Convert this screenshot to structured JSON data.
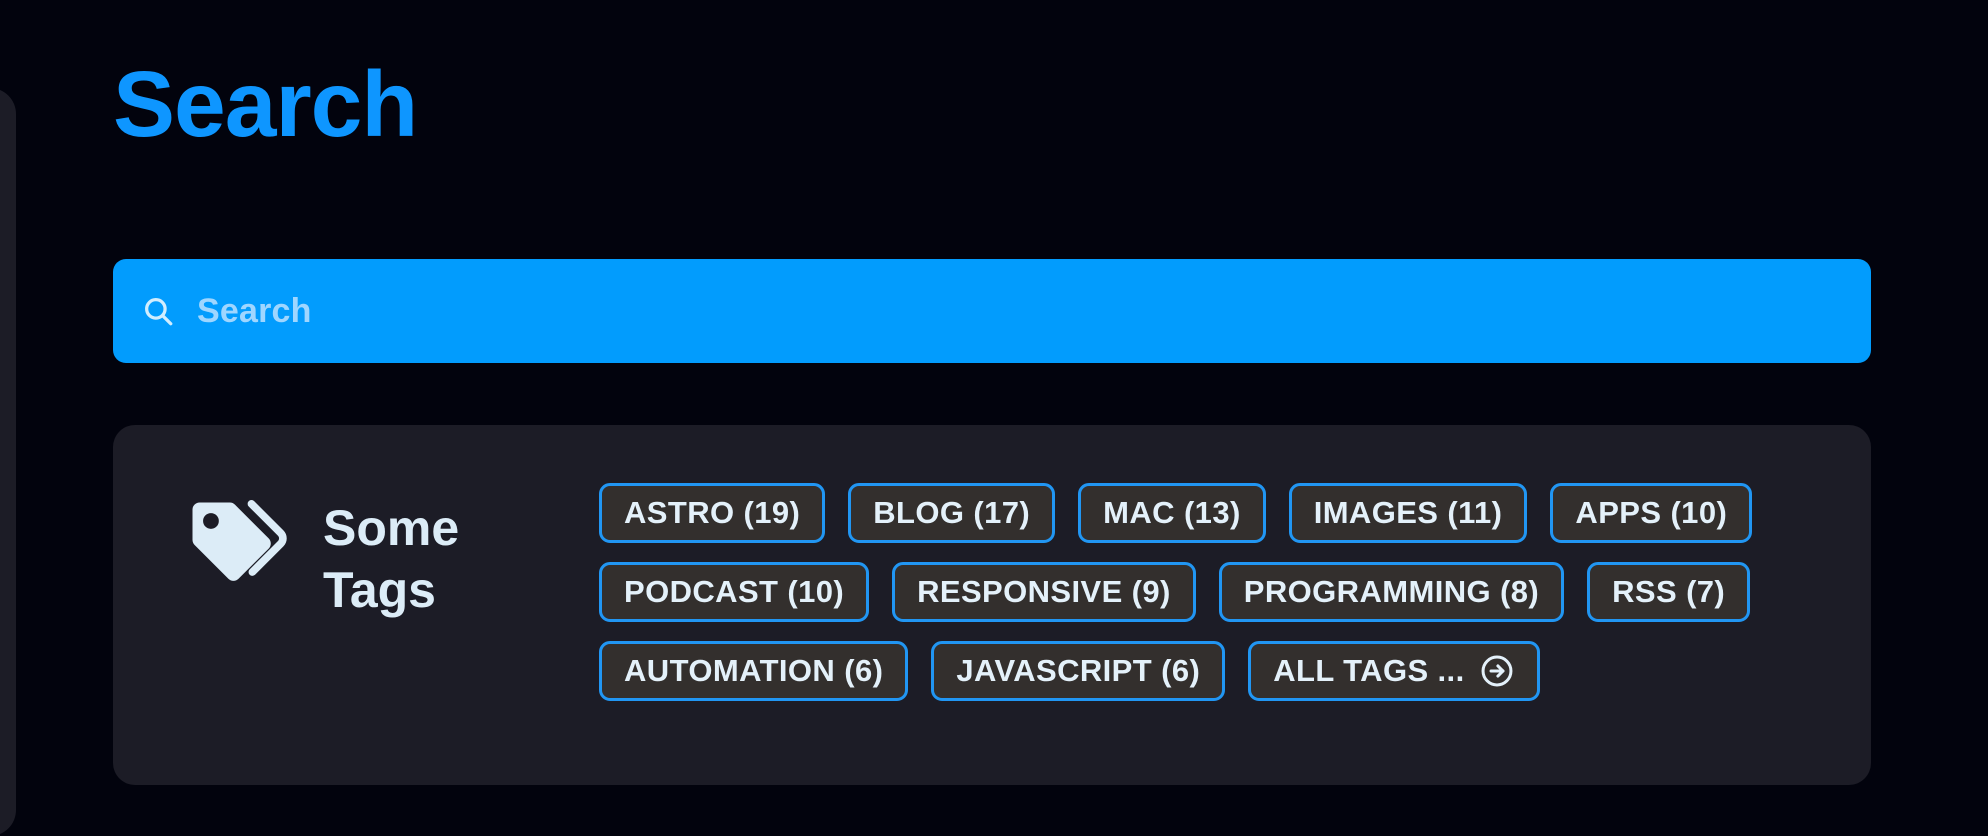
{
  "page": {
    "title": "Search",
    "background_color": "#02030d"
  },
  "search": {
    "icon": "search-icon",
    "value": "",
    "placeholder": "Search",
    "background_color": "#029cfd",
    "placeholder_color": "#9fd6ff"
  },
  "tags_card": {
    "icon": "tags-icon",
    "heading": "Some Tags",
    "background_color": "#1c1c26",
    "chip_border_color": "#2196f3",
    "chip_fill_color": "#332f2d",
    "chips": [
      {
        "label": "ASTRO (19)",
        "name": "astro",
        "count": 19,
        "icon": null
      },
      {
        "label": "BLOG (17)",
        "name": "blog",
        "count": 17,
        "icon": null
      },
      {
        "label": "MAC (13)",
        "name": "mac",
        "count": 13,
        "icon": null
      },
      {
        "label": "IMAGES (11)",
        "name": "images",
        "count": 11,
        "icon": null
      },
      {
        "label": "APPS (10)",
        "name": "apps",
        "count": 10,
        "icon": null
      },
      {
        "label": "PODCAST (10)",
        "name": "podcast",
        "count": 10,
        "icon": null
      },
      {
        "label": "RESPONSIVE (9)",
        "name": "responsive",
        "count": 9,
        "icon": null
      },
      {
        "label": "PROGRAMMING (8)",
        "name": "programming",
        "count": 8,
        "icon": null
      },
      {
        "label": "RSS (7)",
        "name": "rss",
        "count": 7,
        "icon": null
      },
      {
        "label": "AUTOMATION (6)",
        "name": "automation",
        "count": 6,
        "icon": null
      },
      {
        "label": "JAVASCRIPT (6)",
        "name": "javascript",
        "count": 6,
        "icon": null
      },
      {
        "label": "ALL TAGS ...",
        "name": "all-tags",
        "count": null,
        "icon": "arrow-right-circle-icon"
      }
    ]
  }
}
